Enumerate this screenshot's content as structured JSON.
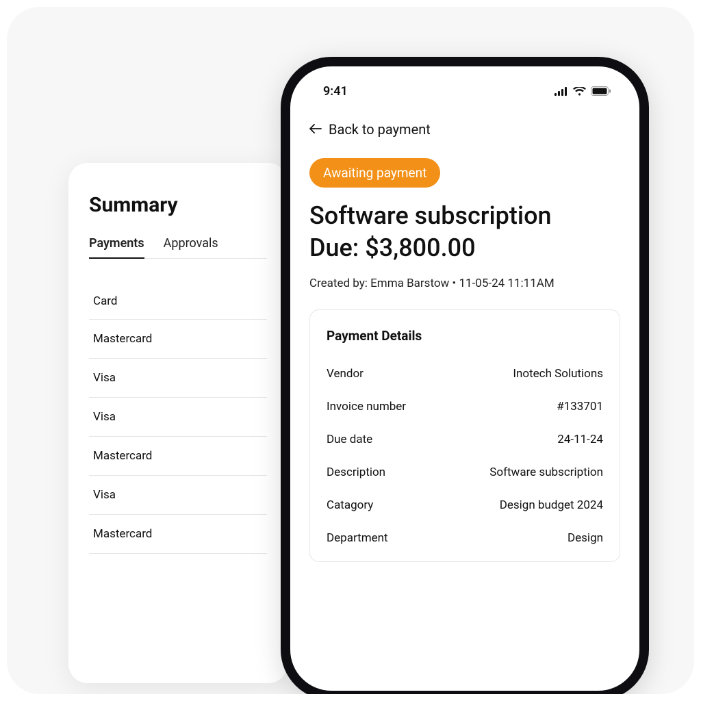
{
  "summary": {
    "title": "Summary",
    "tabs": [
      "Payments",
      "Approvals"
    ],
    "activeTab": 0,
    "columnHeader": "Card",
    "rows": [
      "Mastercard",
      "Visa",
      "Visa",
      "Mastercard",
      "Visa",
      "Mastercard"
    ]
  },
  "phone": {
    "statusTime": "9:41",
    "back": "Back to payment",
    "statusPill": "Awaiting payment",
    "titleLine1": "Software subscription",
    "titleLine2": "Due: $3,800.00",
    "createdBy": "Created by: Emma Barstow • 11-05-24 11:11AM",
    "details": {
      "heading": "Payment Details",
      "rows": [
        {
          "label": "Vendor",
          "value": "Inotech Solutions"
        },
        {
          "label": "Invoice number",
          "value": "#133701"
        },
        {
          "label": "Due date",
          "value": "24-11-24"
        },
        {
          "label": "Description",
          "value": "Software subscription"
        },
        {
          "label": "Catagory",
          "value": "Design budget 2024"
        },
        {
          "label": "Department",
          "value": "Design"
        }
      ]
    }
  }
}
